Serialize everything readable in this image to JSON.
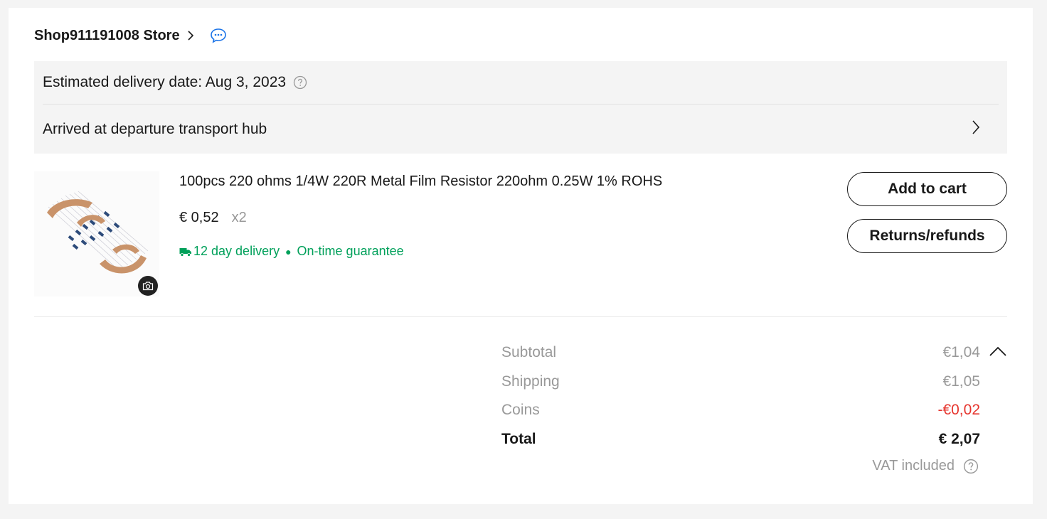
{
  "store": {
    "name": "Shop911191008 Store"
  },
  "delivery": {
    "estimated": "Estimated delivery date: Aug 3, 2023",
    "status": "Arrived at departure transport hub"
  },
  "product": {
    "title": "100pcs 220 ohms 1/4W 220R Metal Film Resistor 220ohm 0.25W 1% ROHS",
    "price": "€ 0,52",
    "quantity": "x2",
    "delivery_time": "12 day delivery",
    "guarantee": "On-time guarantee"
  },
  "actions": {
    "add_to_cart": "Add to cart",
    "returns": "Returns/refunds"
  },
  "summary": {
    "subtotal_label": "Subtotal",
    "subtotal_value": "€1,04",
    "shipping_label": "Shipping",
    "shipping_value": "€1,05",
    "coins_label": "Coins",
    "coins_value": "-€0,02",
    "total_label": "Total",
    "total_value": "€ 2,07",
    "vat": "VAT included"
  },
  "colors": {
    "accent_green": "#00a05a",
    "discount_red": "#e6352e",
    "chat_blue": "#1a73e8"
  },
  "icons": [
    "chevron-right-icon",
    "chat-icon",
    "help-icon",
    "truck-icon",
    "camera-icon",
    "chevron-up-icon"
  ]
}
